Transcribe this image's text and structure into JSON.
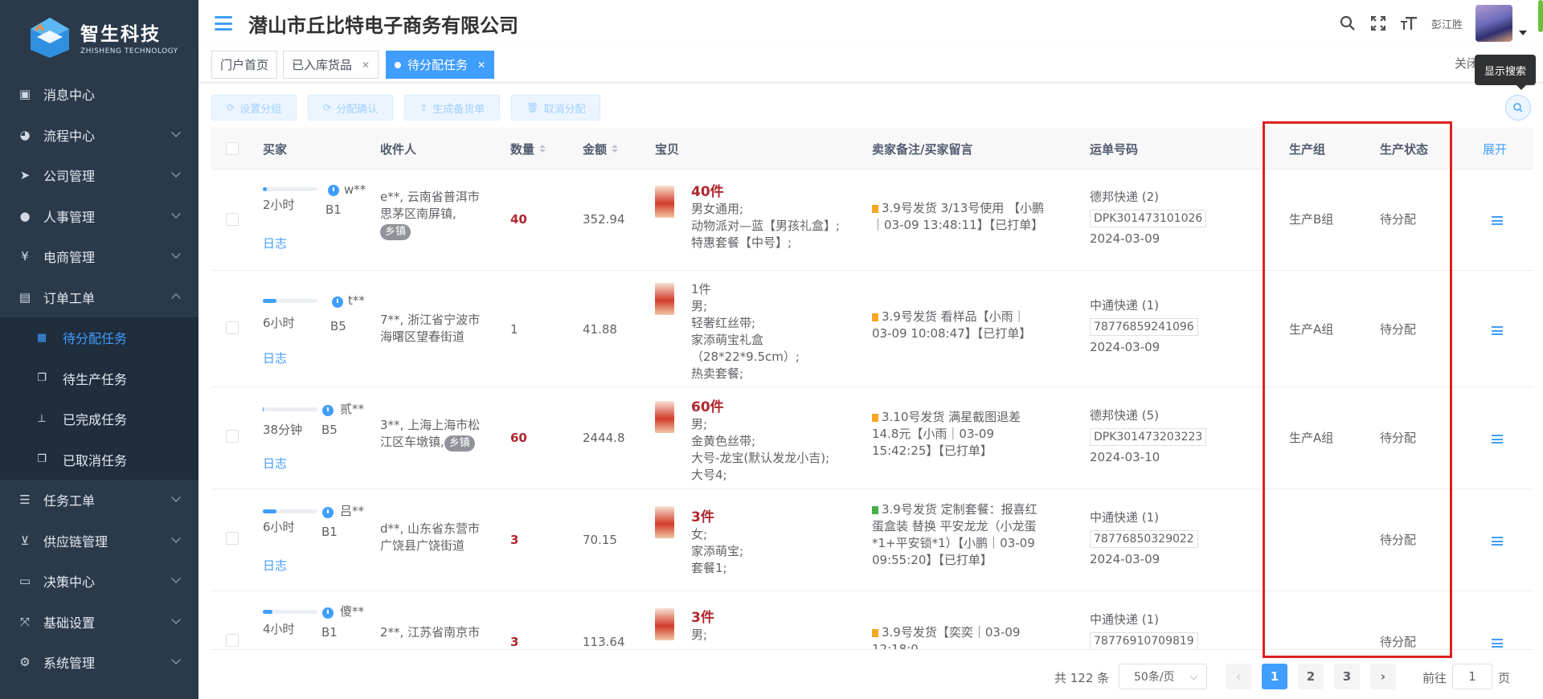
{
  "brand": {
    "name": "智生科技",
    "sub": "ZHISHENG TECHNOLOGY"
  },
  "sidebar": {
    "items": [
      {
        "label": "消息中心",
        "icon": "message-icon",
        "has_arrow": false
      },
      {
        "label": "流程中心",
        "icon": "flow-icon",
        "has_arrow": true
      },
      {
        "label": "公司管理",
        "icon": "send-icon",
        "has_arrow": true
      },
      {
        "label": "人事管理",
        "icon": "user-icon",
        "has_arrow": true
      },
      {
        "label": "电商管理",
        "icon": "yen-icon",
        "has_arrow": true
      },
      {
        "label": "订单工单",
        "icon": "order-icon",
        "has_arrow": true,
        "expanded": true
      }
    ],
    "subitems": [
      {
        "label": "待分配任务",
        "icon": "task-icon",
        "active": true
      },
      {
        "label": "待生产任务",
        "icon": "copy-icon",
        "active": false
      },
      {
        "label": "已完成任务",
        "icon": "org-icon",
        "active": false
      },
      {
        "label": "已取消任务",
        "icon": "copy-icon",
        "active": false
      }
    ],
    "items2": [
      {
        "label": "任务工单",
        "icon": "list-icon"
      },
      {
        "label": "供应链管理",
        "icon": "cart-icon"
      },
      {
        "label": "决策中心",
        "icon": "monitor-icon"
      },
      {
        "label": "基础设置",
        "icon": "expand-icon"
      },
      {
        "label": "系统管理",
        "icon": "settings-icon"
      }
    ]
  },
  "header": {
    "company": "潜山市丘比特电子商务有限公司",
    "username": "彭江胜"
  },
  "tags": [
    {
      "label": "门户首页",
      "closable": false,
      "active": false
    },
    {
      "label": "已入库货品",
      "closable": true,
      "active": false
    },
    {
      "label": "待分配任务",
      "closable": true,
      "active": true
    }
  ],
  "close_all": "关闭",
  "tooltip": "显示搜索",
  "toolbar": [
    "设置分组",
    "分配确认",
    "生成备货单",
    "取消分配"
  ],
  "table": {
    "headers": {
      "buyer": "买家",
      "receiver": "收件人",
      "qty": "数量",
      "amount": "金额",
      "item": "宝贝",
      "remark": "卖家备注/买家留言",
      "tracking": "运单号码",
      "group": "生产组",
      "status": "生产状态",
      "expand": "展开"
    },
    "log_label": "日志",
    "rows": [
      {
        "progress": 0.08,
        "elapsed": "2小时",
        "buyer": "w**",
        "level": "B1",
        "receiver": "e**, 云南省普洱市思茅区南屏镇,",
        "town": "乡镇",
        "qty": "40",
        "amount": "352.94",
        "count": "40件",
        "item_lines": [
          "男女通用;",
          "动物派对—蓝【男孩礼盒】;",
          "特惠套餐【中号】;"
        ],
        "flag": "orange",
        "remark": "3.9号发货 3/13号使用 【小鹏｜03-09 13:48:11】【已打单】",
        "courier": "德邦快递 (2)",
        "tracking": "DPK301473101026",
        "date": "2024-03-09",
        "group": "生产B组",
        "status": "待分配"
      },
      {
        "progress": 0.25,
        "elapsed": "6小时",
        "buyer": "t**",
        "level": "B5",
        "receiver": "7**, 浙江省宁波市海曙区望春街道",
        "town": "",
        "qty": "1",
        "amount": "41.88",
        "count": "1件",
        "item_lines": [
          "男;",
          "轻奢红丝带;",
          "家添萌宝礼盒（28*22*9.5cm）;",
          "热卖套餐;"
        ],
        "flag": "orange",
        "remark": "3.9号发货 看样品【小雨｜03-09 10:08:47】【已打单】",
        "courier": "中通快递 (1)",
        "tracking": "78776859241096",
        "date": "2024-03-09",
        "group": "生产A组",
        "status": "待分配"
      },
      {
        "progress": 0.02,
        "elapsed": "38分钟",
        "buyer": "贰**",
        "level": "B5",
        "receiver": "3**, 上海上海市松江区车墩镇,",
        "town": "乡镇",
        "qty": "60",
        "amount": "2444.8",
        "count": "60件",
        "item_lines": [
          "男;",
          "金黄色丝带;",
          "大号-龙宝(默认发龙小吉);",
          "大号4;"
        ],
        "flag": "orange",
        "remark": "3.10号发货 满星截图退差14.8元【小雨｜03-09 15:42:25】【已打单】",
        "courier": "德邦快递 (5)",
        "tracking": "DPK301473203223",
        "date": "2024-03-10",
        "group": "生产A组",
        "status": "待分配"
      },
      {
        "progress": 0.25,
        "elapsed": "6小时",
        "buyer": "吕**",
        "level": "B1",
        "receiver": "d**, 山东省东营市广饶县广饶街道",
        "town": "",
        "qty": "3",
        "amount": "70.15",
        "count": "3件",
        "item_lines": [
          "女;",
          "家添萌宝;",
          "套餐1;"
        ],
        "flag": "green",
        "remark": "3.9号发货 定制套餐：报喜红蛋盒装 替换 平安龙龙（小龙蛋*1+平安锁*1）【小鹏｜03-09 09:55:20】【已打单】",
        "courier": "中通快递 (1)",
        "tracking": "78776850329022",
        "date": "2024-03-09",
        "group": "",
        "status": "待分配"
      },
      {
        "progress": 0.18,
        "elapsed": "4小时",
        "buyer": "傻**",
        "level": "B1",
        "receiver": "2**, 江苏省南京市",
        "town": "",
        "qty": "3",
        "amount": "113.64",
        "count": "3件",
        "item_lines": [
          "男;"
        ],
        "flag": "orange",
        "remark": "3.9号发货【奕奕｜03-09 12:18:0",
        "courier": "中通快递 (1)",
        "tracking": "78776910709819",
        "date": "",
        "group": "",
        "status": "待分配"
      }
    ]
  },
  "pagination": {
    "total": "共 122 条",
    "page_size": "50条/页",
    "pages": [
      "1",
      "2",
      "3"
    ],
    "current": "1",
    "goto_label": "前往",
    "goto_value": "1",
    "page_unit": "页"
  },
  "colors": {
    "primary": "#409eff",
    "sidebar": "#2b3a4b",
    "highlight_box": "#e02020"
  }
}
